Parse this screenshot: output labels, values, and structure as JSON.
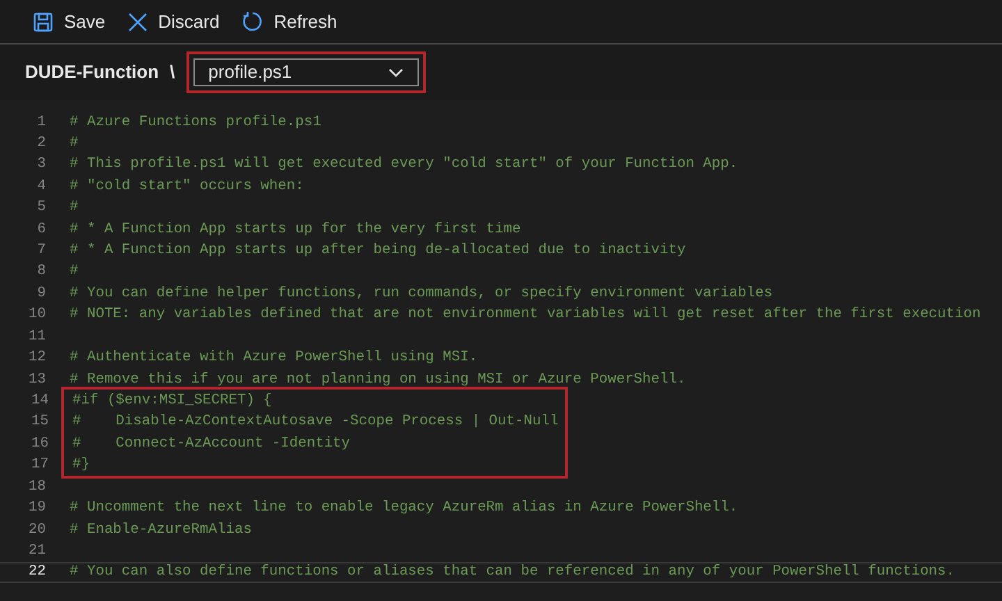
{
  "toolbar": [
    {
      "kind": "save",
      "label": "Save"
    },
    {
      "kind": "discard",
      "label": "Discard"
    },
    {
      "kind": "refresh",
      "label": "Refresh"
    }
  ],
  "breadcrumb": {
    "app": "DUDE-Function",
    "separator": "\\",
    "file": {
      "value": "profile.ps1",
      "highlighted": true
    }
  },
  "editor": {
    "lines": [
      {
        "number": "1",
        "text": "# Azure Functions profile.ps1",
        "highlighted": false,
        "current": false
      },
      {
        "number": "2",
        "text": "#",
        "highlighted": false,
        "current": false
      },
      {
        "number": "3",
        "text": "# This profile.ps1 will get executed every \"cold start\" of your Function App.",
        "highlighted": false,
        "current": false
      },
      {
        "number": "4",
        "text": "# \"cold start\" occurs when:",
        "highlighted": false,
        "current": false
      },
      {
        "number": "5",
        "text": "#",
        "highlighted": false,
        "current": false
      },
      {
        "number": "6",
        "text": "# * A Function App starts up for the very first time",
        "highlighted": false,
        "current": false
      },
      {
        "number": "7",
        "text": "# * A Function App starts up after being de-allocated due to inactivity",
        "highlighted": false,
        "current": false
      },
      {
        "number": "8",
        "text": "#",
        "highlighted": false,
        "current": false
      },
      {
        "number": "9",
        "text": "# You can define helper functions, run commands, or specify environment variables",
        "highlighted": false,
        "current": false
      },
      {
        "number": "10",
        "text": "# NOTE: any variables defined that are not environment variables will get reset after the first execution",
        "highlighted": false,
        "current": false
      },
      {
        "number": "11",
        "highlighted": false,
        "current": false
      },
      {
        "number": "12",
        "text": "# Authenticate with Azure PowerShell using MSI.",
        "highlighted": false,
        "current": false
      },
      {
        "number": "13",
        "text": "# Remove this if you are not planning on using MSI or Azure PowerShell.",
        "highlighted": false,
        "current": false
      },
      {
        "number": "14",
        "text": "#if ($env:MSI_SECRET) {",
        "highlighted": true,
        "current": false
      },
      {
        "number": "15",
        "text": "#    Disable-AzContextAutosave -Scope Process | Out-Null",
        "highlighted": true,
        "current": false
      },
      {
        "number": "16",
        "text": "#    Connect-AzAccount -Identity",
        "highlighted": true,
        "current": false
      },
      {
        "number": "17",
        "text": "#}",
        "highlighted": true,
        "current": false
      },
      {
        "number": "18",
        "highlighted": false,
        "current": false
      },
      {
        "number": "19",
        "text": "# Uncomment the next line to enable legacy AzureRm alias in Azure PowerShell.",
        "highlighted": false,
        "current": false
      },
      {
        "number": "20",
        "text": "# Enable-AzureRmAlias",
        "highlighted": false,
        "current": false
      },
      {
        "number": "21",
        "highlighted": false,
        "current": false
      },
      {
        "number": "22",
        "text": "# You can also define functions or aliases that can be referenced in any of your PowerShell functions.",
        "highlighted": false,
        "current": true
      }
    ]
  }
}
